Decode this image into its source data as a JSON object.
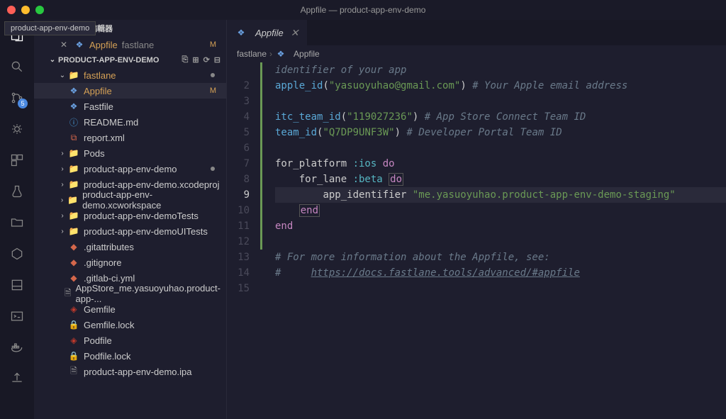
{
  "window": {
    "title": "Appfile — product-app-env-demo"
  },
  "tooltip": "product-app-env-demo",
  "activity": {
    "scm_badge": "5"
  },
  "explorer": {
    "open_editors_label": "已開啟的編輯器",
    "open_editor_item": {
      "name": "Appfile",
      "path": "fastlane",
      "status": "M"
    },
    "project_header": "PRODUCT-APP-ENV-DEMO",
    "tree": {
      "fastlane": {
        "label": "fastlane",
        "files": [
          {
            "name": "Appfile",
            "status": "M"
          },
          {
            "name": "Fastfile"
          },
          {
            "name": "README.md"
          },
          {
            "name": "report.xml"
          }
        ]
      },
      "folders": [
        {
          "name": "Pods"
        },
        {
          "name": "product-app-env-demo",
          "dot": true
        },
        {
          "name": "product-app-env-demo.xcodeproj"
        },
        {
          "name": "product-app-env-demo.xcworkspace"
        },
        {
          "name": "product-app-env-demoTests"
        },
        {
          "name": "product-app-env-demoUITests"
        }
      ],
      "files": [
        {
          "name": ".gitattributes",
          "icon": "git"
        },
        {
          "name": ".gitignore",
          "icon": "git"
        },
        {
          "name": ".gitlab-ci.yml",
          "icon": "git"
        },
        {
          "name": "AppStore_me.yasuoyuhao.product-app-...",
          "icon": "file"
        },
        {
          "name": "Gemfile",
          "icon": "ruby"
        },
        {
          "name": "Gemfile.lock",
          "icon": "lock"
        },
        {
          "name": "Podfile",
          "icon": "ruby"
        },
        {
          "name": "Podfile.lock",
          "icon": "lock"
        },
        {
          "name": "product-app-env-demo.ipa",
          "icon": "file"
        }
      ]
    }
  },
  "tab": {
    "name": "Appfile"
  },
  "breadcrumb": {
    "seg1": "fastlane",
    "seg2": "Appfile"
  },
  "code": {
    "lines": [
      {
        "n": "",
        "t": "identifier of your app",
        "cls": "cmt-only"
      },
      {
        "n": "2",
        "t": "apple_id(\"yasuoyuhao@gmail.com\") # Your Apple email address"
      },
      {
        "n": "3",
        "t": ""
      },
      {
        "n": "4",
        "t": "itc_team_id(\"119027236\") # App Store Connect Team ID"
      },
      {
        "n": "5",
        "t": "team_id(\"Q7DP9UNF3W\") # Developer Portal Team ID"
      },
      {
        "n": "6",
        "t": ""
      },
      {
        "n": "7",
        "t": "for_platform :ios do"
      },
      {
        "n": "8",
        "t": "    for_lane :beta do"
      },
      {
        "n": "9",
        "t": "        app_identifier \"me.yasuoyuhao.product-app-env-demo-staging\"",
        "hl": true
      },
      {
        "n": "10",
        "t": "    end"
      },
      {
        "n": "11",
        "t": "end"
      },
      {
        "n": "12",
        "t": ""
      },
      {
        "n": "13",
        "t": "# For more information about the Appfile, see:"
      },
      {
        "n": "14",
        "t": "#     https://docs.fastlane.tools/advanced/#appfile"
      },
      {
        "n": "15",
        "t": ""
      }
    ]
  }
}
